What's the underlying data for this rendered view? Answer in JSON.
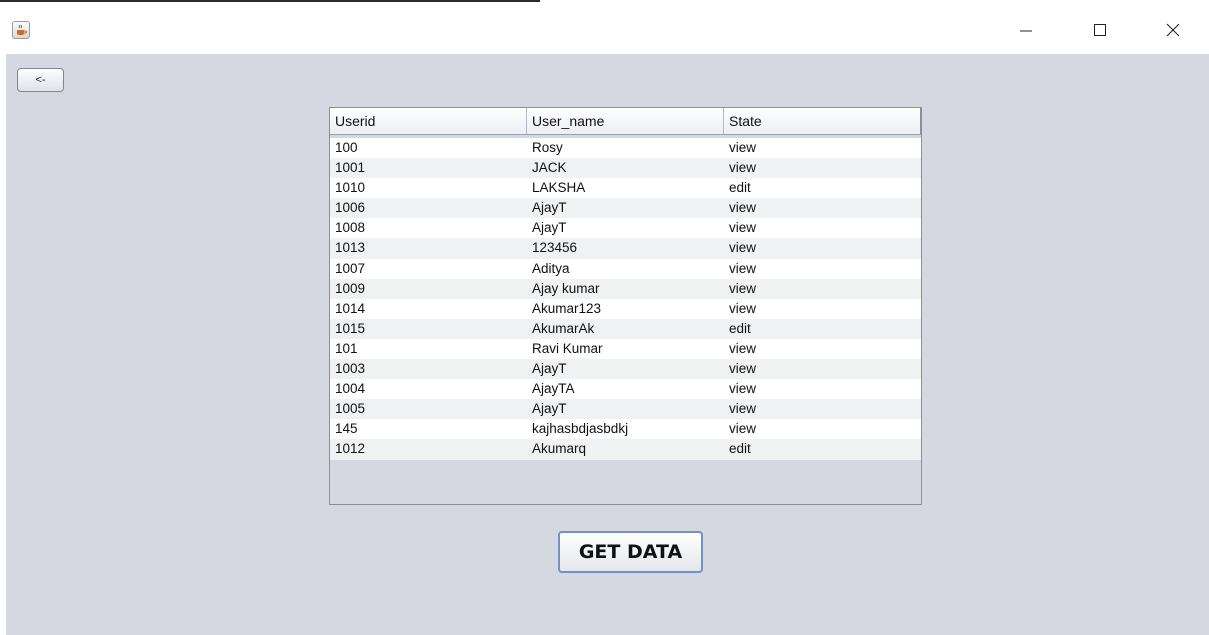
{
  "window": {
    "icon": "java-coffee-icon",
    "controls": {
      "minimize_icon": "minimize-icon",
      "maximize_icon": "maximize-icon",
      "close_icon": "close-icon"
    }
  },
  "toolbar": {
    "back_label": "<-"
  },
  "table": {
    "columns": [
      "Userid",
      "User_name",
      "State"
    ],
    "rows": [
      [
        "100",
        "Rosy",
        "view"
      ],
      [
        "1001",
        "JACK",
        "view"
      ],
      [
        "1010",
        "LAKSHA",
        "edit"
      ],
      [
        "1006",
        "AjayT",
        "view"
      ],
      [
        "1008",
        "AjayT",
        "view"
      ],
      [
        "1013",
        "123456",
        "view"
      ],
      [
        "1007",
        "Aditya",
        "view"
      ],
      [
        "1009",
        "Ajay kumar",
        "view"
      ],
      [
        "1014",
        "Akumar123",
        "view"
      ],
      [
        "1015",
        "AkumarAk",
        "edit"
      ],
      [
        "101",
        "Ravi Kumar",
        "view"
      ],
      [
        "1003",
        "AjayT",
        "view"
      ],
      [
        "1004",
        "AjayTA",
        "view"
      ],
      [
        "1005",
        "AjayT",
        "view"
      ],
      [
        "145",
        "kajhasbdjasbdkj",
        "view"
      ],
      [
        "1012",
        "Akumarq",
        "edit"
      ]
    ]
  },
  "actions": {
    "get_data_label": "GET DATA"
  },
  "colors": {
    "content_bg": "#d5d8e1",
    "button_focus_border": "#6f93c4"
  }
}
